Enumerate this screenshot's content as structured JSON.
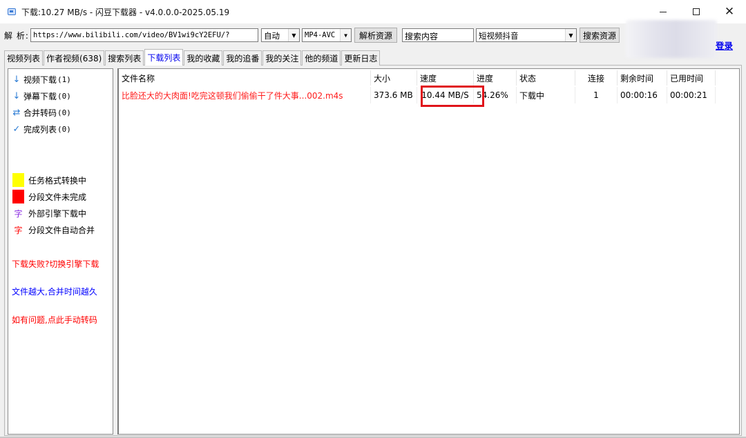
{
  "window": {
    "title": "下载:10.27 MB/s - 闪豆下载器 - v4.0.0.0-2025.05.19",
    "icon": "app-icon",
    "controls": [
      "minimize",
      "maximize",
      "close"
    ]
  },
  "toolbar": {
    "parse_label": "解 析:",
    "url_value": "https://www.bilibili.com/video/BV1wi9cY2EFU/?",
    "quality_select": "自动",
    "format_select": "MP4-AVC",
    "parse_button": "解析资源",
    "search_value": "搜索内容",
    "source_select": "短视频抖音",
    "search_button": "搜索资源",
    "login_link": "登录"
  },
  "tabs": [
    {
      "label": "视频列表",
      "active": false
    },
    {
      "label": "作者视频(638)",
      "active": false
    },
    {
      "label": "搜索列表",
      "active": false
    },
    {
      "label": "下载列表",
      "active": true
    },
    {
      "label": "我的收藏",
      "active": false
    },
    {
      "label": "我的追番",
      "active": false
    },
    {
      "label": "我的关注",
      "active": false
    },
    {
      "label": "他的频道",
      "active": false
    },
    {
      "label": "更新日志",
      "active": false
    }
  ],
  "sidebar": {
    "items": [
      {
        "label": "视频下载",
        "count": "(1)",
        "icon": "arrow-down-icon"
      },
      {
        "label": "弹幕下载",
        "count": "(0)",
        "icon": "arrow-down-icon"
      },
      {
        "label": "合并转码",
        "count": "(0)",
        "icon": "swap-arrows-icon"
      },
      {
        "label": "完成列表",
        "count": "(0)",
        "icon": "checkmark-icon"
      }
    ],
    "legend": [
      {
        "label": "任务格式转换中",
        "color": "#ffff00"
      },
      {
        "label": "分段文件未完成",
        "color": "#ff0000"
      },
      {
        "label": "外部引擎下载中",
        "glyph": "字",
        "color": "#8a2be2"
      },
      {
        "label": "分段文件自动合并",
        "glyph": "字",
        "color": "#ff0000"
      }
    ],
    "notes": [
      {
        "text": "下载失败?切换引擎下载",
        "color": "#ff0000"
      },
      {
        "text": "文件越大,合并时间越久",
        "color": "#0000ff"
      },
      {
        "text": "如有问题,点此手动转码",
        "color": "#ff0000"
      }
    ]
  },
  "download_list": {
    "columns": [
      "文件名称",
      "大小",
      "速度",
      "进度",
      "状态",
      "连接",
      "剩余时间",
      "已用时间"
    ],
    "rows": [
      {
        "name": "比脸还大的大肉面!吃完这顿我们偷偷干了件大事...002.m4s",
        "size": "373.6 MB",
        "speed": "10.44 MB/S",
        "progress": "54.26%",
        "status": "下载中",
        "connections": "1",
        "remaining": "00:00:16",
        "elapsed": "00:00:21"
      }
    ],
    "highlight_color": "#e0141a"
  }
}
